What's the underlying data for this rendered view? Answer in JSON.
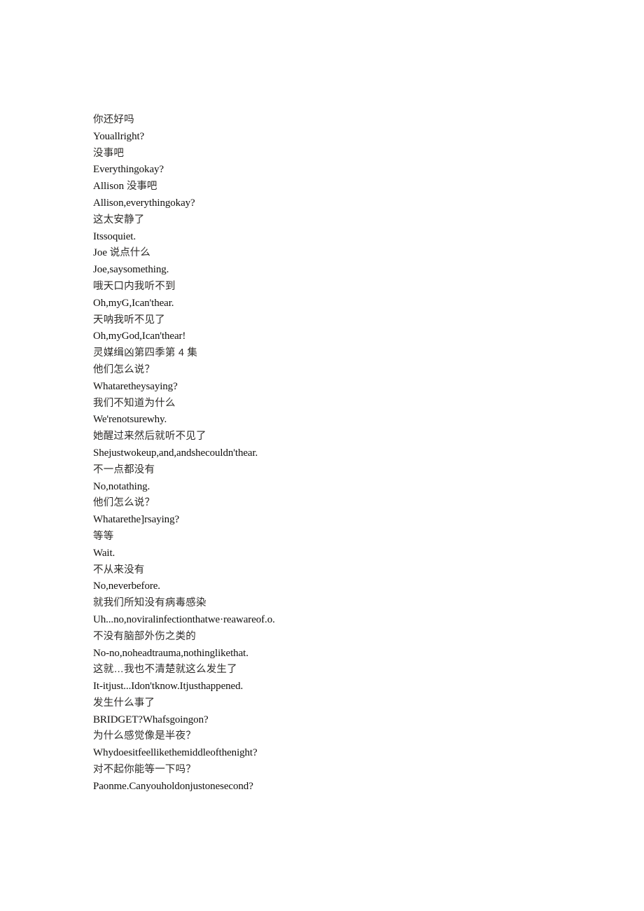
{
  "document": {
    "title": "灵媒缉凶第四季第 4 集",
    "background_color": "#ffffff",
    "latin_text_color": "#100f0d",
    "han_text_color": "#2e2c2a"
  },
  "transcript": {
    "lines": [
      {
        "script": "han",
        "text": "你还好吗"
      },
      {
        "script": "latin",
        "text": "Youallright?"
      },
      {
        "script": "han",
        "text": "没事吧"
      },
      {
        "script": "latin",
        "text": "Everythingokay?"
      },
      {
        "script": "mixed",
        "latin_part": "Allison ",
        "han_part": "没事吧",
        "text": "Allison 没事吧"
      },
      {
        "script": "latin",
        "text": "Allison,everythingokay?"
      },
      {
        "script": "han",
        "text": "这太安静了"
      },
      {
        "script": "latin",
        "text": "Itssoquiet."
      },
      {
        "script": "mixed",
        "latin_part": "Joe ",
        "han_part": "说点什么",
        "text": "Joe 说点什么"
      },
      {
        "script": "latin",
        "text": "Joe,saysomething."
      },
      {
        "script": "han",
        "text": "哦天口内我听不到"
      },
      {
        "script": "latin",
        "text": "Oh,myG,Ican'thear."
      },
      {
        "script": "han",
        "text": "天呐我听不见了"
      },
      {
        "script": "latin",
        "text": "Oh,myGod,Ican'thear!"
      },
      {
        "script": "han",
        "text": "灵媒缉凶第四季第 4 集"
      },
      {
        "script": "han",
        "text": "他们怎么说？"
      },
      {
        "script": "latin",
        "text": "Whataretheysaying?"
      },
      {
        "script": "han",
        "text": "我们不知道为什么"
      },
      {
        "script": "latin",
        "text": "We'renotsurewhy."
      },
      {
        "script": "han",
        "text": "她醒过来然后就听不见了"
      },
      {
        "script": "latin",
        "text": "Shejustwokeup,and,andshecouldn'thear."
      },
      {
        "script": "han",
        "text": "不一点都没有"
      },
      {
        "script": "latin",
        "text": "No,notathing."
      },
      {
        "script": "han",
        "text": "他们怎么说？"
      },
      {
        "script": "latin",
        "text": "Whatarethe]rsaying?"
      },
      {
        "script": "han",
        "text": "等等"
      },
      {
        "script": "latin",
        "text": "Wait."
      },
      {
        "script": "han",
        "text": "不从来没有"
      },
      {
        "script": "latin",
        "text": "No,neverbefore."
      },
      {
        "script": "han",
        "text": "就我们所知没有病毒感染"
      },
      {
        "script": "latin",
        "text": "Uh...no,noviralinfectionthatwe·reawareof.o."
      },
      {
        "script": "han",
        "text": "不没有脑部外伤之类的"
      },
      {
        "script": "latin",
        "text": "No-no,noheadtrauma,nothinglikethat."
      },
      {
        "script": "han",
        "text": "这就…我也不清楚就这么发生了"
      },
      {
        "script": "latin",
        "text": "It-itjust...Idon'tknow.Itjusthappened."
      },
      {
        "script": "han",
        "text": "发生什么事了"
      },
      {
        "script": "latin",
        "text": "BRIDGET?Whafsgoingon?"
      },
      {
        "script": "han",
        "text": "为什么感觉像是半夜？"
      },
      {
        "script": "latin",
        "text": "Whydoesitfeellikethemiddleofthenight?"
      },
      {
        "script": "han",
        "text": "对不起你能等一下吗？"
      },
      {
        "script": "latin",
        "text": "Paonme.Canyouholdonjustonesecond?"
      }
    ]
  }
}
